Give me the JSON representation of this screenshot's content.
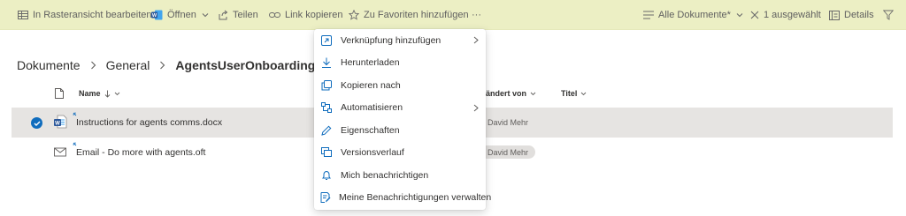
{
  "colors": {
    "command_bar_bg": "#ecefc4",
    "selected_row_bg": "#e6e4e2",
    "accent_blue": "#0f6cbd",
    "word_blue": "#2b579a"
  },
  "toolbar": {
    "grid_edit": "In Rasteransicht bearbeiten",
    "open": "Öffnen",
    "share": "Teilen",
    "copy_link": "Link kopieren",
    "add_favorites": "Zu Favoriten hinzufügen",
    "more": "···",
    "view": "Alle Dokumente*",
    "selected": "1 ausgewählt",
    "details": "Details"
  },
  "breadcrumb": {
    "items": [
      "Dokumente",
      "General",
      "AgentsUserOnboardingTempla"
    ]
  },
  "columns": {
    "name": "Name",
    "modified_by": "eändert von",
    "title": "Titel"
  },
  "files": [
    {
      "name": "Instructions for agents comms.docx",
      "modified_by": "David Mehr",
      "icon": "word-doc-icon"
    },
    {
      "name": "Email - Do more with agents.oft",
      "modified_by": "David Mehr",
      "icon": "mail-template-icon"
    }
  ],
  "menu": {
    "items": [
      {
        "label": "Verknüpfung hinzufügen",
        "icon": "shortcut-icon",
        "submenu": true
      },
      {
        "label": "Herunterladen",
        "icon": "download-icon",
        "submenu": false
      },
      {
        "label": "Kopieren nach",
        "icon": "copy-icon",
        "submenu": false
      },
      {
        "label": "Automatisieren",
        "icon": "automate-icon",
        "submenu": true
      },
      {
        "label": "Eigenschaften",
        "icon": "pencil-icon",
        "submenu": false
      },
      {
        "label": "Versionsverlauf",
        "icon": "version-history-icon",
        "submenu": false
      },
      {
        "label": "Mich benachrichtigen",
        "icon": "bell-icon",
        "submenu": false
      },
      {
        "label": "Meine Benachrichtigungen verwalten",
        "icon": "manage-alerts-icon",
        "submenu": false
      }
    ]
  }
}
